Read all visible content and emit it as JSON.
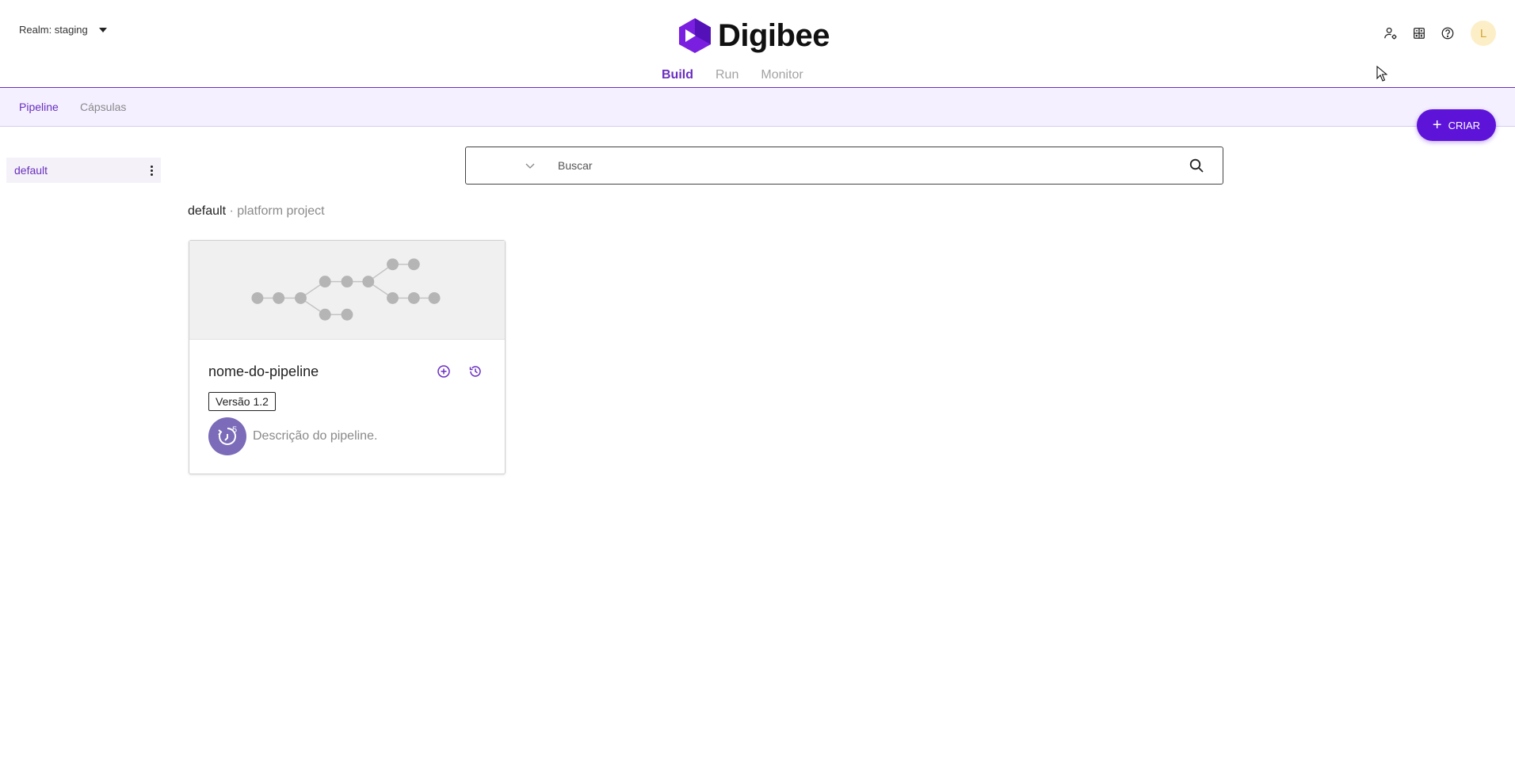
{
  "header": {
    "realm_label": "Realm: staging",
    "brand": "Digibee",
    "nav": [
      {
        "label": "Build",
        "active": true
      },
      {
        "label": "Run",
        "active": false
      },
      {
        "label": "Monitor",
        "active": false
      }
    ],
    "icons": [
      "user-cog-icon",
      "calculator-icon",
      "help-icon"
    ],
    "avatar_initial": "L"
  },
  "subnav": {
    "items": [
      {
        "label": "Pipeline",
        "active": true
      },
      {
        "label": "Cápsulas",
        "active": false
      }
    ]
  },
  "create_button": {
    "label": "CRIAR"
  },
  "sidebar": {
    "projects": [
      {
        "label": "default",
        "selected": true
      }
    ]
  },
  "search": {
    "placeholder": "Buscar",
    "value": ""
  },
  "breadcrumb": {
    "project": "default",
    "separator": " · ",
    "description": "platform project"
  },
  "pipeline_card": {
    "name": "nome-do-pipeline",
    "version": "Versão 1.2",
    "description": "Descrição do pipeline.",
    "avatar_badge": "5"
  },
  "colors": {
    "accent": "#6a2fc0",
    "primary_button": "#5d14d8",
    "subnav_bg": "#f4f0ff",
    "avatar_bg": "#fcefc8"
  }
}
